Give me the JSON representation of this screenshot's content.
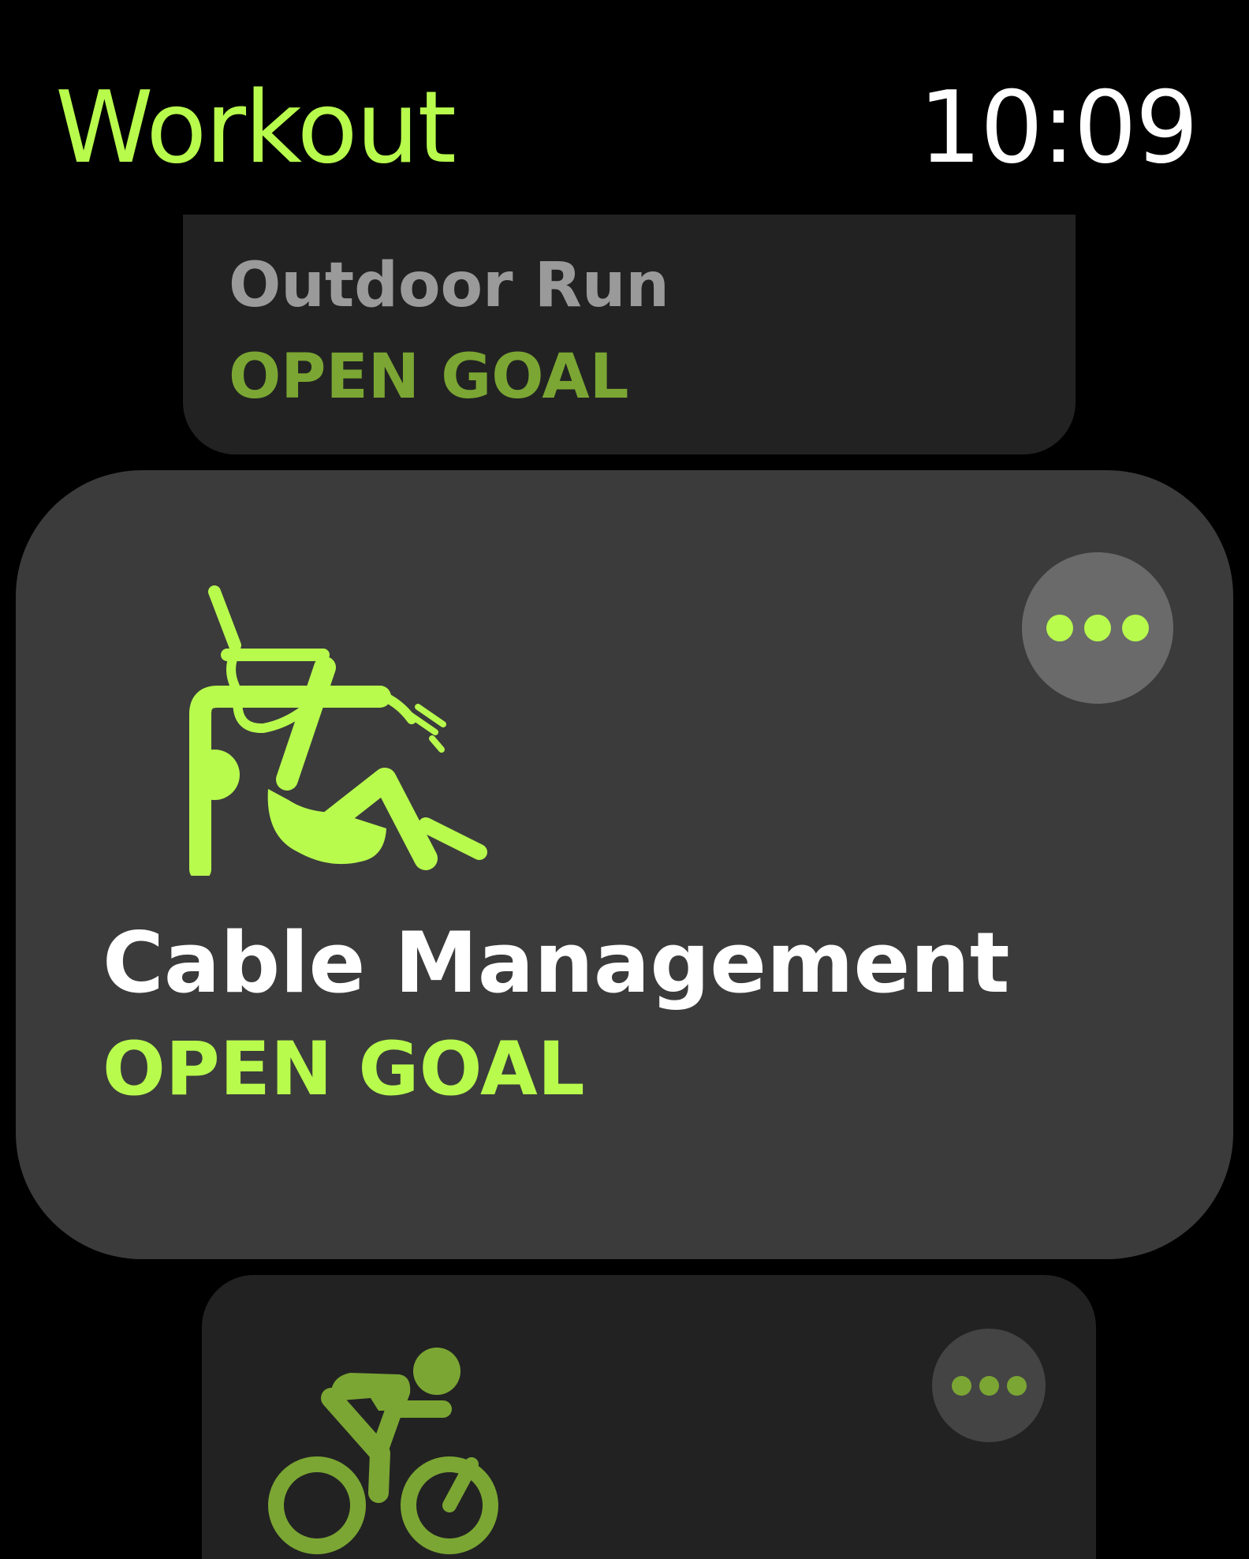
{
  "app": {
    "title": "Workout",
    "time": "10:09"
  },
  "colors": {
    "accent": "#b8fb4d",
    "accent_dim": "#7ba633",
    "white": "#ffffff"
  },
  "workouts": [
    {
      "title": "Outdoor Run",
      "goal": "OPEN GOAL",
      "icon": "running-icon"
    },
    {
      "title": "Cable Management",
      "goal": "OPEN GOAL",
      "icon": "cable-management-icon",
      "more_icon": "more-options-icon"
    },
    {
      "icon": "outdoor-cycle-icon",
      "more_icon": "more-options-icon"
    }
  ]
}
